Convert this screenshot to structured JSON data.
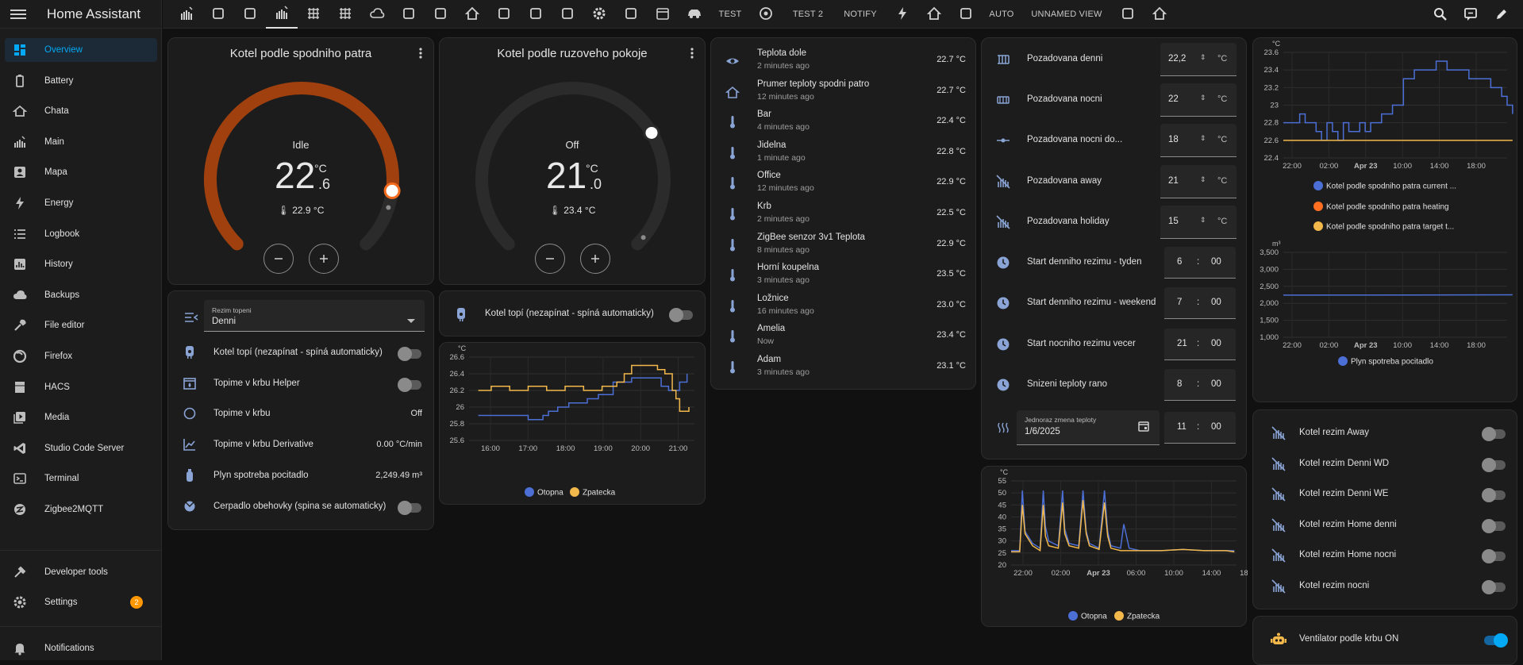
{
  "app": {
    "title": "Home Assistant"
  },
  "sidebar": {
    "items": [
      {
        "label": "Overview",
        "icon": "dashboard-icon",
        "selected": true
      },
      {
        "label": "Battery",
        "icon": "battery-icon"
      },
      {
        "label": "Chata",
        "icon": "house-icon"
      },
      {
        "label": "Main",
        "icon": "radiator-icon"
      },
      {
        "label": "Mapa",
        "icon": "account-box-icon"
      },
      {
        "label": "Energy",
        "icon": "lightning-icon"
      },
      {
        "label": "Logbook",
        "icon": "list-icon"
      },
      {
        "label": "History",
        "icon": "chart-box-icon"
      },
      {
        "label": "Backups",
        "icon": "cloud-icon"
      },
      {
        "label": "File editor",
        "icon": "wrench-icon"
      },
      {
        "label": "Firefox",
        "icon": "firefox-icon"
      },
      {
        "label": "HACS",
        "icon": "hacs-icon"
      },
      {
        "label": "Media",
        "icon": "play-box-icon"
      },
      {
        "label": "Studio Code Server",
        "icon": "vscode-icon"
      },
      {
        "label": "Terminal",
        "icon": "console-icon"
      },
      {
        "label": "Zigbee2MQTT",
        "icon": "zigbee-icon"
      }
    ],
    "developer_tools": "Developer tools",
    "settings": "Settings",
    "settings_badge": "2",
    "notifications": "Notifications"
  },
  "topbar": {
    "tabs": [
      {
        "type": "icon",
        "name": "radiator-icon"
      },
      {
        "type": "icon",
        "name": "flash-radiator-icon"
      },
      {
        "type": "icon",
        "name": "fireplace-icon"
      },
      {
        "type": "icon",
        "name": "radiator-active-icon",
        "active": true
      },
      {
        "type": "icon",
        "name": "heater-icon"
      },
      {
        "type": "icon",
        "name": "heating-coil-icon"
      },
      {
        "type": "icon",
        "name": "cloud-upload-icon"
      },
      {
        "type": "icon",
        "name": "water-icon"
      },
      {
        "type": "icon",
        "name": "water-boiler-icon"
      },
      {
        "type": "icon",
        "name": "home-city-icon"
      },
      {
        "type": "icon",
        "name": "fridge-icon"
      },
      {
        "type": "icon",
        "name": "watering-can-icon"
      },
      {
        "type": "icon",
        "name": "account-group-icon"
      },
      {
        "type": "icon",
        "name": "cog-icon"
      },
      {
        "type": "icon",
        "name": "tv-icon"
      },
      {
        "type": "icon",
        "name": "calendar-icon"
      },
      {
        "type": "icon",
        "name": "car-icon"
      },
      {
        "type": "text",
        "label": "TEST"
      },
      {
        "type": "icon",
        "name": "robot-vacuum-icon"
      },
      {
        "type": "text",
        "label": "TEST 2"
      },
      {
        "type": "text",
        "label": "NOTIFY"
      },
      {
        "type": "icon",
        "name": "flash-icon"
      },
      {
        "type": "icon",
        "name": "home-roof-icon"
      },
      {
        "type": "icon",
        "name": "ceiling-light-icon"
      },
      {
        "type": "text",
        "label": "AUTO"
      },
      {
        "type": "text",
        "label": "UNNAMED VIEW"
      },
      {
        "type": "icon",
        "name": "robot-mower-icon"
      },
      {
        "type": "icon",
        "name": "home-export-icon"
      }
    ]
  },
  "thermostats": [
    {
      "title": "Kotel podle spodniho patra",
      "state": "Idle",
      "target_int": "22",
      "target_dec": ".6",
      "unit": "°C",
      "current": "22.9 °C",
      "setpoint_fraction": 0.86,
      "active_color": "#a0400e"
    },
    {
      "title": "Kotel podle ruzoveho pokoje",
      "state": "Off",
      "target_int": "21",
      "target_dec": ".0",
      "unit": "°C",
      "current": "23.4 °C",
      "setpoint_fraction": 0.72,
      "active_color": "#2b2b2b"
    }
  ],
  "left_entities": {
    "select": {
      "label": "Rezim topeni",
      "value": "Denni"
    },
    "rows": [
      {
        "name": "Kotel topí (nezapínat - spíná automaticky)",
        "type": "toggle",
        "on": false,
        "icon": "water-boiler-icon"
      },
      {
        "name": "Topime v krbu Helper",
        "type": "toggle",
        "on": false,
        "icon": "fireplace-icon"
      },
      {
        "name": "Topime v krbu",
        "type": "text",
        "value": "Off",
        "icon": "circle-outline-icon"
      },
      {
        "name": "Topime v krbu Derivative",
        "type": "text",
        "value": "0.00 °C/min",
        "icon": "chart-line-icon"
      },
      {
        "name": "Plyn spotreba pocitadlo",
        "type": "text",
        "value": "2,249.49 m³",
        "icon": "gas-cylinder-icon"
      },
      {
        "name": "Cerpadlo obehovky (spina se automaticky)",
        "type": "toggle",
        "on": false,
        "icon": "pump-icon"
      }
    ]
  },
  "boiler_card": {
    "name": "Kotel topí (nezapínat - spíná automaticky)",
    "on": false
  },
  "temps_list": [
    {
      "name": "Teplota dole",
      "time": "2 minutes ago",
      "value": "22.7 °C",
      "icon": "eye-icon"
    },
    {
      "name": "Prumer teploty spodni patro",
      "time": "12 minutes ago",
      "value": "22.7 °C",
      "icon": "home-outline-icon"
    },
    {
      "name": "Bar",
      "time": "4 minutes ago",
      "value": "22.4 °C",
      "icon": "thermometer-icon"
    },
    {
      "name": "Jidelna",
      "time": "1 minute ago",
      "value": "22.8 °C",
      "icon": "thermometer-icon"
    },
    {
      "name": "Office",
      "time": "12 minutes ago",
      "value": "22.9 °C",
      "icon": "thermometer-icon"
    },
    {
      "name": "Krb",
      "time": "2 minutes ago",
      "value": "22.5 °C",
      "icon": "thermometer-icon"
    },
    {
      "name": "ZigBee senzor 3v1 Teplota",
      "time": "8 minutes ago",
      "value": "22.9 °C",
      "icon": "thermometer-icon"
    },
    {
      "name": "Horní koupelna",
      "time": "3 minutes ago",
      "value": "23.5 °C",
      "icon": "thermometer-icon"
    },
    {
      "name": "Ložnice",
      "time": "16 minutes ago",
      "value": "23.0 °C",
      "icon": "thermometer-icon"
    },
    {
      "name": "Amelia",
      "time": "Now",
      "value": "23.4 °C",
      "icon": "thermometer-icon"
    },
    {
      "name": "Adam",
      "time": "3 minutes ago",
      "value": "23.1 °C",
      "icon": "thermometer-icon"
    }
  ],
  "settings_card": {
    "numbers": [
      {
        "name": "Pozadovana denni",
        "value": "22,2",
        "unit": "°C",
        "icon": "radiator-icon"
      },
      {
        "name": "Pozadovana nocni",
        "value": "22",
        "unit": "°C",
        "icon": "heater-icon"
      },
      {
        "name": "Pozadovana nocni do...",
        "value": "18",
        "unit": "°C",
        "icon": "ray-vertex-icon"
      },
      {
        "name": "Pozadovana away",
        "value": "21",
        "unit": "°C",
        "icon": "radiator-off-icon"
      },
      {
        "name": "Pozadovana holiday",
        "value": "15",
        "unit": "°C",
        "icon": "radiator-off-icon"
      }
    ],
    "times": [
      {
        "name": "Start denniho rezimu - tyden",
        "hh": "6",
        "mm": "00"
      },
      {
        "name": "Start denniho rezimu - weekend",
        "hh": "7",
        "mm": "00"
      },
      {
        "name": "Start nocniho rezimu vecer",
        "hh": "21",
        "mm": "00"
      },
      {
        "name": "Snizeni teploty rano",
        "hh": "8",
        "mm": "00"
      }
    ],
    "datetime": {
      "label": "Jednoraz zmena teploty",
      "date": "1/6/2025",
      "hh": "11",
      "mm": "00"
    }
  },
  "right_toggles": [
    {
      "name": "Kotel rezim Away",
      "on": false
    },
    {
      "name": "Kotel rezim Denni WD",
      "on": false
    },
    {
      "name": "Kotel rezim Denni WE",
      "on": false
    },
    {
      "name": "Kotel rezim Home denni",
      "on": false
    },
    {
      "name": "Kotel rezim Home nocni",
      "on": false
    },
    {
      "name": "Kotel rezim nocni",
      "on": false
    }
  ],
  "fan_card": {
    "name": "Ventilator podle krbu ON",
    "on": true
  },
  "chart_data": [
    {
      "id": "otopna-short",
      "type": "line",
      "ylabel": "°C",
      "ylim": [
        25.6,
        26.6
      ],
      "yticks": [
        "25.6",
        "25.8",
        "26",
        "26.2",
        "26.4",
        "26.6"
      ],
      "xticks": [
        "16:00",
        "17:00",
        "18:00",
        "19:00",
        "20:00",
        "21:00"
      ],
      "series": [
        {
          "name": "Otopna",
          "color": "#4c6fd6",
          "x": [
            15.65,
            16.1,
            16.4,
            16.7,
            17.0,
            17.4,
            17.55,
            17.8,
            18.1,
            18.4,
            18.6,
            18.9,
            19.3,
            19.8,
            20.2,
            20.4,
            20.6,
            20.8,
            21.1,
            21.3
          ],
          "values": [
            25.9,
            25.9,
            25.9,
            25.9,
            25.85,
            25.9,
            25.95,
            26.0,
            26.05,
            26.05,
            26.1,
            26.15,
            26.3,
            26.35,
            26.35,
            26.35,
            26.25,
            26.2,
            26.3,
            26.4
          ]
        },
        {
          "name": "Zpatecka",
          "color": "#f2b84b",
          "x": [
            15.65,
            16.0,
            16.5,
            17.0,
            17.5,
            18.0,
            18.5,
            19.0,
            19.4,
            19.6,
            19.8,
            20.0,
            20.3,
            20.5,
            20.7,
            20.9,
            21.0,
            21.1,
            21.25,
            21.35
          ],
          "values": [
            26.2,
            26.25,
            26.2,
            26.25,
            26.2,
            26.25,
            26.2,
            26.25,
            26.3,
            26.4,
            26.5,
            26.5,
            26.5,
            26.45,
            26.4,
            26.2,
            26.1,
            25.95,
            25.95,
            26.0
          ]
        }
      ]
    },
    {
      "id": "otopna-long",
      "type": "line",
      "ylabel": "°C",
      "ylim": [
        20,
        55
      ],
      "yticks": [
        "20",
        "25",
        "30",
        "35",
        "40",
        "45",
        "50",
        "55"
      ],
      "xticks": [
        "22:00",
        "02:00",
        "Apr 23",
        "06:00",
        "10:00",
        "14:00",
        "18:00"
      ],
      "series": [
        {
          "name": "Otopna",
          "color": "#4c6fd6",
          "x": [
            0,
            0.8,
            1.05,
            1.3,
            2,
            2.7,
            3.0,
            3.2,
            3.5,
            4.4,
            4.8,
            5.0,
            5.4,
            6.3,
            6.7,
            7.0,
            7.3,
            8.2,
            8.7,
            9.0,
            9.3,
            10.2,
            10.5,
            11,
            12,
            14,
            16,
            18,
            20,
            20.8
          ],
          "values": [
            26,
            26,
            51,
            34,
            29,
            27,
            51,
            36,
            30,
            28,
            51,
            35,
            29,
            28,
            51,
            34,
            29,
            27,
            51,
            34,
            28,
            27,
            37,
            27,
            26,
            26,
            26.5,
            26,
            26,
            26
          ]
        },
        {
          "name": "Zpatecka",
          "color": "#f2b84b",
          "x": [
            0,
            0.8,
            1.05,
            1.3,
            2,
            2.7,
            3.0,
            3.2,
            3.5,
            4.4,
            4.8,
            5.0,
            5.4,
            6.3,
            6.7,
            7.0,
            7.3,
            8.2,
            8.7,
            9.0,
            9.3,
            10.2,
            11,
            12,
            14,
            16,
            18,
            20,
            20.8
          ],
          "values": [
            25.5,
            25.5,
            45,
            33,
            28,
            26,
            45,
            32,
            28,
            27,
            46,
            33,
            28,
            27,
            47,
            33,
            28,
            26.5,
            46,
            32,
            27,
            26,
            26,
            26,
            26,
            26.5,
            26,
            26,
            25.5
          ]
        }
      ]
    },
    {
      "id": "kotel-spodni",
      "type": "line",
      "ylabel": "°C",
      "ylim": [
        22.4,
        23.6
      ],
      "yticks": [
        "22.4",
        "22.6",
        "22.8",
        "23",
        "23.2",
        "23.4",
        "23.6"
      ],
      "xticks": [
        "22:00",
        "02:00",
        "Apr 23",
        "10:00",
        "14:00",
        "18:00"
      ],
      "series": [
        {
          "name": "Kotel podle spodniho patra current ...",
          "color": "#4c6fd6",
          "x": [
            0,
            1,
            1.5,
            2,
            3,
            3.5,
            4,
            4.5,
            5,
            5.5,
            6,
            7,
            7.5,
            8,
            9,
            10,
            11,
            12,
            13,
            14,
            15,
            16,
            17,
            18,
            19,
            20,
            20.5,
            21
          ],
          "values": [
            22.8,
            22.8,
            22.9,
            22.8,
            22.7,
            22.6,
            22.8,
            22.7,
            22.6,
            22.8,
            22.7,
            22.8,
            22.7,
            22.8,
            22.9,
            23.0,
            23.3,
            23.4,
            23.4,
            23.5,
            23.4,
            23.4,
            23.3,
            23.3,
            23.2,
            23.1,
            23.0,
            22.9
          ]
        },
        {
          "name": "Kotel podle spodniho patra heating",
          "color": "#ff6f22",
          "x": [],
          "values": []
        },
        {
          "name": "Kotel podle spodniho patra target t...",
          "color": "#f2b84b",
          "x": [
            0,
            21
          ],
          "values": [
            22.6,
            22.6
          ]
        }
      ]
    },
    {
      "id": "plyn",
      "type": "line",
      "ylabel": "m³",
      "ylim": [
        1000,
        3500
      ],
      "yticks": [
        "1,000",
        "1,500",
        "2,000",
        "2,500",
        "3,000",
        "3,500"
      ],
      "xticks": [
        "22:00",
        "02:00",
        "Apr 23",
        "10:00",
        "14:00",
        "18:00"
      ],
      "series": [
        {
          "name": "Plyn spotreba pocitadlo",
          "color": "#4c6fd6",
          "x": [
            0,
            21
          ],
          "values": [
            2240,
            2249
          ]
        }
      ]
    }
  ]
}
